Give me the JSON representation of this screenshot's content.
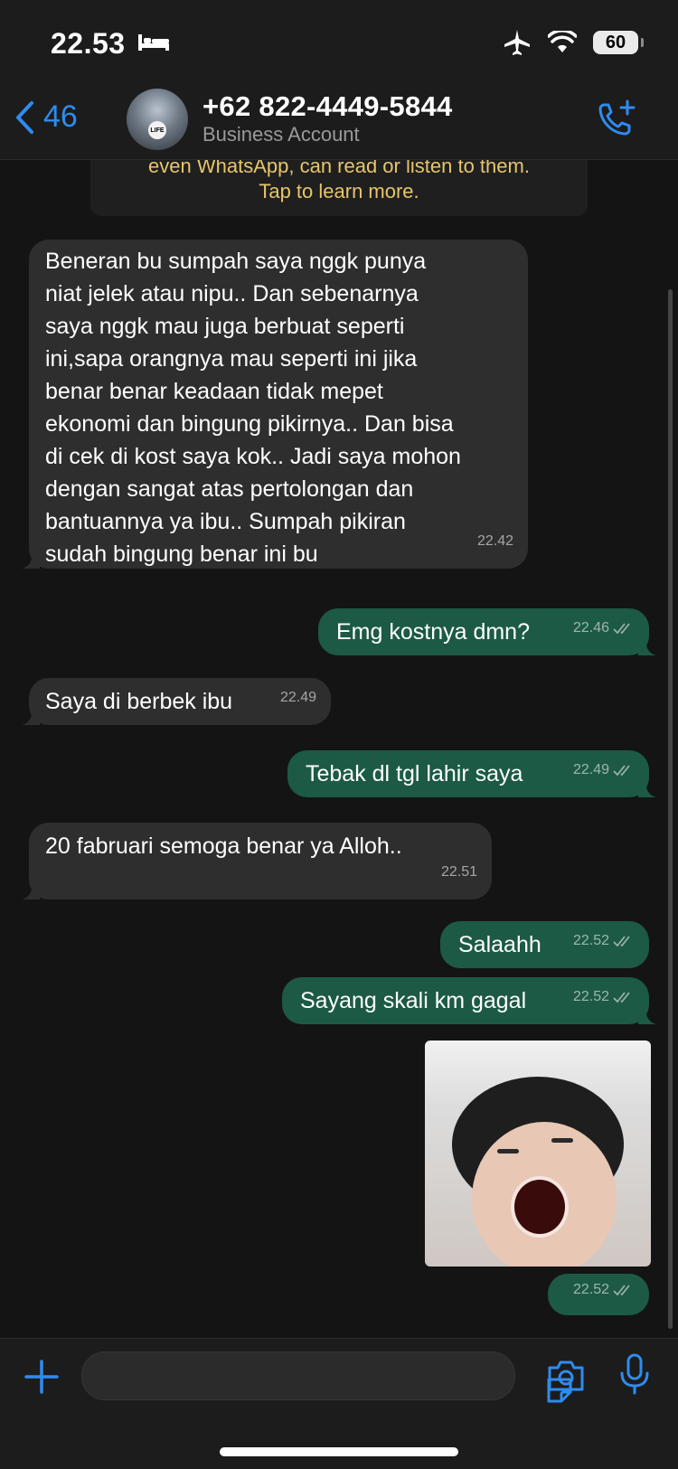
{
  "status_bar": {
    "time": "22.53",
    "battery": "60"
  },
  "header": {
    "back_count": "46",
    "contact_name": "+62 822-4449-5844",
    "contact_sub": "Business Account"
  },
  "notice": {
    "line1": "even WhatsApp, can read or listen to them.",
    "line2": "Tap to learn more."
  },
  "messages": [
    {
      "dir": "in",
      "time": "22.42",
      "lines": [
        "Beneran bu sumpah saya nggk punya",
        "niat jelek atau nipu.. Dan sebenarnya",
        "saya nggk mau juga berbuat seperti",
        "ini,sapa orangnya mau seperti ini jika",
        "benar benar keadaan tidak mepet",
        "ekonomi dan bingung pikirnya.. Dan bisa",
        "di cek di kost saya kok.. Jadi saya mohon",
        "dengan sangat atas pertolongan dan",
        "bantuannya ya ibu.. Sumpah pikiran",
        "sudah bingung benar ini bu"
      ]
    },
    {
      "dir": "out",
      "time": "22.46",
      "text": "Emg kostnya dmn?"
    },
    {
      "dir": "in",
      "time": "22.49",
      "text": "Saya di berbek ibu"
    },
    {
      "dir": "out",
      "time": "22.49",
      "text": "Tebak dl tgl lahir saya"
    },
    {
      "dir": "in",
      "time": "22.51",
      "text": "20 fabruari semoga benar ya Alloh.."
    },
    {
      "dir": "out",
      "time": "22.52",
      "text": "Salaahh"
    },
    {
      "dir": "out",
      "time": "22.52",
      "text": "Sayang skali km gagal"
    },
    {
      "dir": "out",
      "time": "22.52",
      "type": "image"
    }
  ],
  "colors": {
    "accent": "#2e8cf0",
    "incoming_bubble": "#2e2e2e",
    "outgoing_bubble": "#1c5a46",
    "notice_text": "#e8c56a"
  }
}
